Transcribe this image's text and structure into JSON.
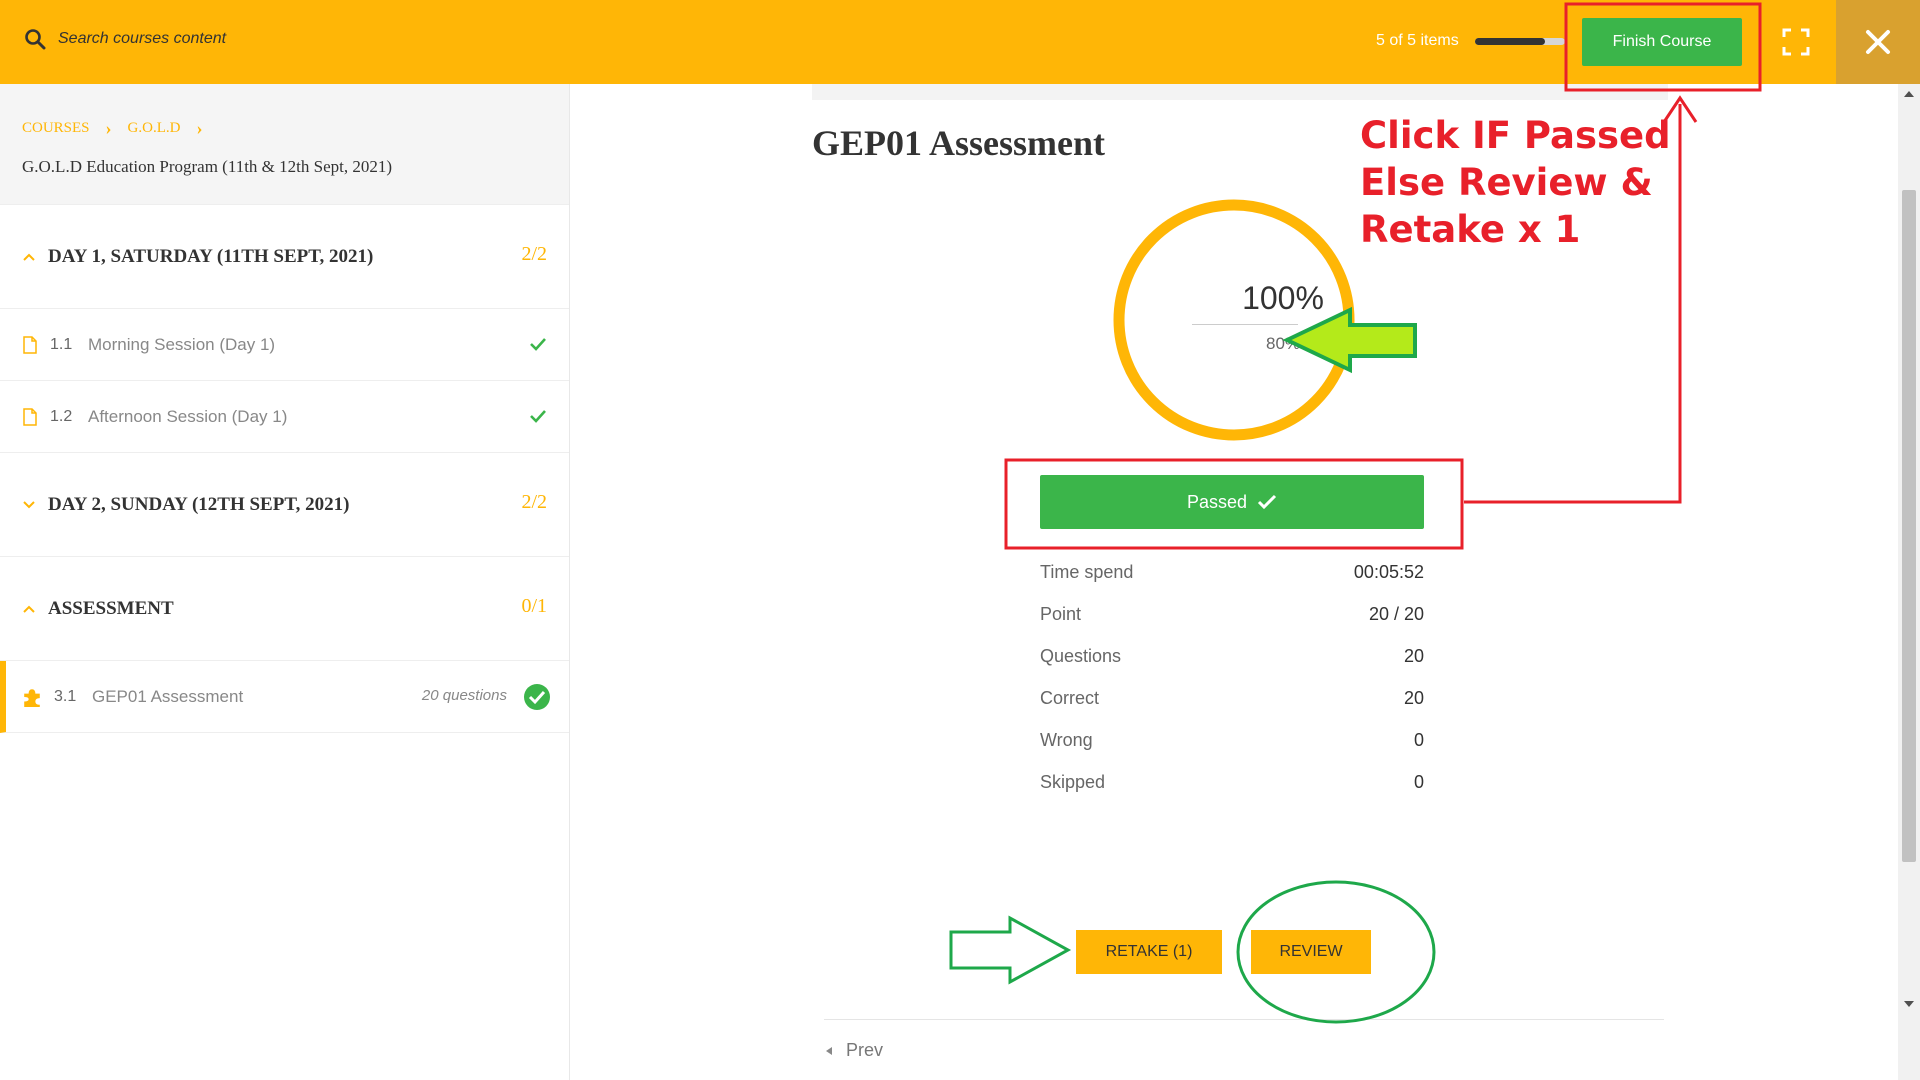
{
  "topbar": {
    "search_placeholder": "Search courses content",
    "items_count": "5 of 5 items",
    "progress_fraction": 0.78,
    "finish_label": "Finish Course"
  },
  "sidebar": {
    "breadcrumb": [
      "COURSES",
      "G.O.L.D"
    ],
    "course_title": "G.O.L.D Education Program (11th & 12th Sept, 2021)",
    "sections": [
      {
        "title": "DAY 1, SATURDAY (11TH SEPT, 2021)",
        "count": "2/2",
        "lessons": [
          {
            "num": "1.1",
            "name": "Morning Session (Day 1)"
          },
          {
            "num": "1.2",
            "name": "Afternoon Session (Day 1)"
          }
        ]
      },
      {
        "title": "DAY 2, SUNDAY (12TH SEPT, 2021)",
        "count": "2/2"
      },
      {
        "title": "ASSESSMENT",
        "count": "0/1",
        "lessons": [
          {
            "num": "3.1",
            "name": "GEP01 Assessment",
            "meta": "20 questions"
          }
        ]
      }
    ]
  },
  "main": {
    "title": "GEP01 Assessment",
    "result_percent": "100%",
    "passing_percent": "80%",
    "status_label": "Passed",
    "stats": [
      {
        "label": "Time spend",
        "value": "00:05:52"
      },
      {
        "label": "Point",
        "value": "20 / 20"
      },
      {
        "label": "Questions",
        "value": "20"
      },
      {
        "label": "Correct",
        "value": "20"
      },
      {
        "label": "Wrong",
        "value": "0"
      },
      {
        "label": "Skipped",
        "value": "0"
      }
    ],
    "retake_label": "RETAKE (1)",
    "review_label": "REVIEW",
    "prev_label": "Prev"
  },
  "annotation": {
    "lines": [
      "Click IF Passed",
      "Else Review &",
      "Retake x 1"
    ]
  },
  "colors": {
    "accent": "#ffb606",
    "success": "#3bb54a",
    "annotation_red": "#e8202a",
    "annotation_green": "#1ea84a"
  }
}
